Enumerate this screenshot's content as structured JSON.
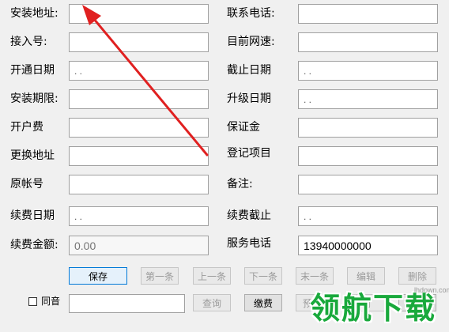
{
  "left_labels": [
    "安装地址:",
    "接入号:",
    "开通日期",
    "安装期限:",
    "开户费",
    "更换地址",
    "原帐号",
    "续费日期",
    "续费金额:"
  ],
  "right_labels": [
    "联系电话:",
    "目前网速:",
    "截止日期",
    "升级日期",
    "保证金",
    "登记项目",
    "备注:",
    "续费截止",
    "服务电话"
  ],
  "left_fields": [
    "",
    "",
    ". .",
    "",
    "",
    "",
    "",
    ". .",
    ""
  ],
  "right_fields": [
    "",
    "",
    ". .",
    ". .",
    "",
    "",
    "",
    ". .",
    "13940000000"
  ],
  "renewal_amount_placeholder": "0.00",
  "buttons": [
    "保存",
    "第一条",
    "上一条",
    "下一条",
    "末一条",
    "编辑",
    "删除"
  ],
  "same_sound_label": "同音",
  "search_value": "",
  "query_button": "查询",
  "renew_button": "缴费",
  "extra_buttons": [
    "预",
    "删",
    "删费"
  ],
  "watermark": "领航下载",
  "watermark_url": "lhdown.com",
  "arrow_color": "#e02020"
}
